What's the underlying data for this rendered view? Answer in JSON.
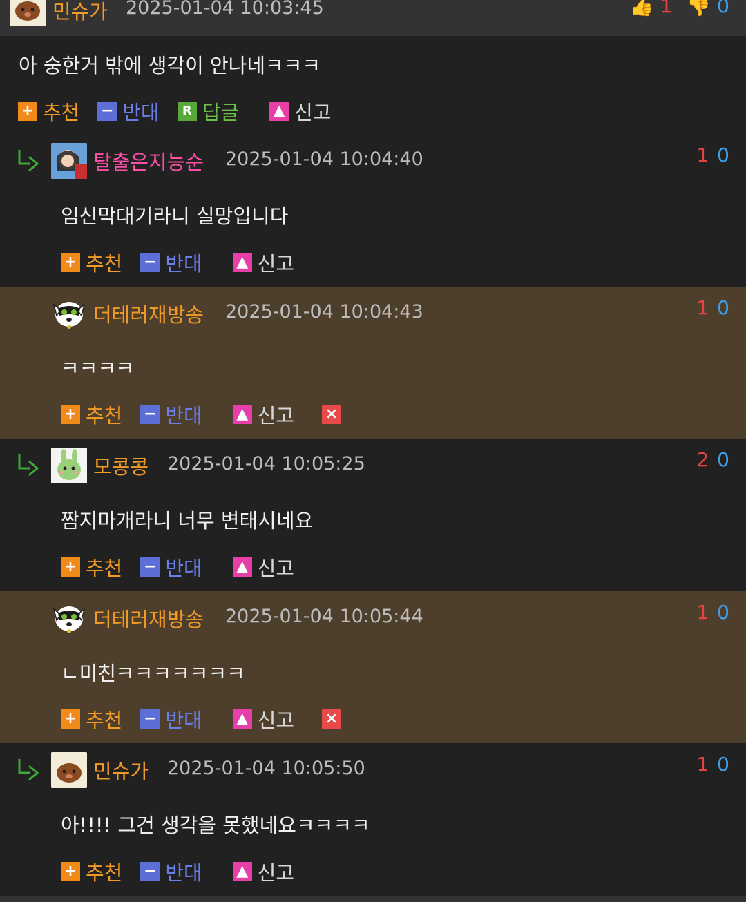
{
  "colors": {
    "background": "#212121",
    "author_highlight": "#4e3e2c",
    "nick_orange": "#f29a26",
    "nick_pink": "#ff4fa8",
    "vote_up": "#e64444",
    "vote_down": "#3fa0e8"
  },
  "actions": {
    "recommend": "추천",
    "oppose": "반대",
    "reply": "답글",
    "report": "신고"
  },
  "top_comment": {
    "nickname": "민슈가",
    "timestamp": "2025-01-04 10:03:45",
    "up": "1",
    "down": "0",
    "text": "아 숭한거 밖에 생각이 안나네ㅋㅋㅋ"
  },
  "replies": [
    {
      "nickname": "탈출은지능순",
      "timestamp": "2025-01-04 10:04:40",
      "up": "1",
      "down": "0",
      "text": "임신막대기라니 실망입니다",
      "avatar": "anime-girl-avatar"
    },
    {
      "nickname": "더테러재방송",
      "timestamp": "2025-01-04 10:04:43",
      "up": "1",
      "down": "0",
      "text": "ㅋㅋㅋㅋ",
      "avatar": "dog-mask-avatar"
    },
    {
      "nickname": "모콩콩",
      "timestamp": "2025-01-04 10:05:25",
      "up": "2",
      "down": "0",
      "text": "짬지마개라니 너무 변태시네요",
      "avatar": "green-rabbit-avatar"
    },
    {
      "nickname": "더테러재방송",
      "timestamp": "2025-01-04 10:05:44",
      "up": "1",
      "down": "0",
      "text": "ㄴ미친ㅋㅋㅋㅋㅋㅋㅋ",
      "avatar": "dog-mask-avatar"
    },
    {
      "nickname": "민슈가",
      "timestamp": "2025-01-04 10:05:50",
      "up": "1",
      "down": "0",
      "text": "아!!!! 그건 생각을 못했네요ㅋㅋㅋㅋ",
      "avatar": "brown-character-avatar"
    }
  ]
}
